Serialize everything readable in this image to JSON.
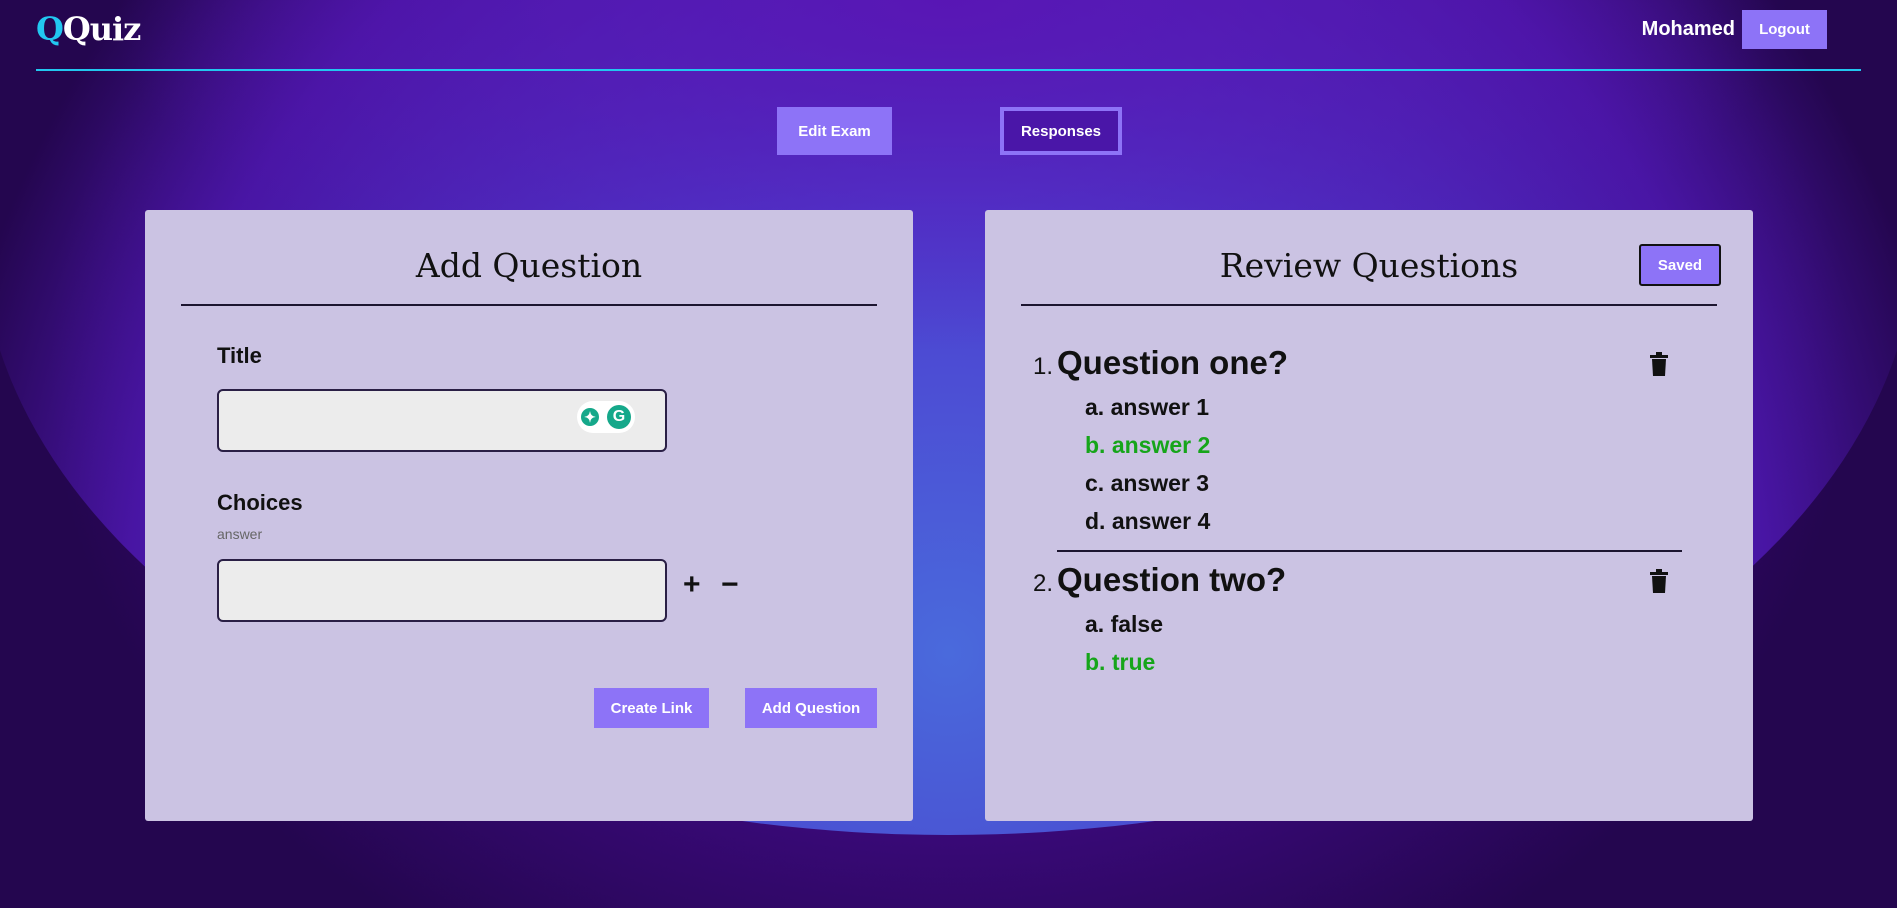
{
  "app": {
    "logo_q": "Q",
    "logo_rest": "Quiz"
  },
  "header": {
    "user_name": "Mohamed",
    "logout_label": "Logout"
  },
  "tabs": {
    "edit_exam_label": "Edit Exam",
    "responses_label": "Responses"
  },
  "add_question": {
    "title": "Add Question",
    "title_label": "Title",
    "title_value": "",
    "choices_label": "Choices",
    "choices_sublabel": "answer",
    "choice_value": "",
    "plus_symbol": "+",
    "minus_symbol": "−",
    "create_link_label": "Create Link",
    "add_question_label": "Add Question"
  },
  "review": {
    "title": "Review Questions",
    "saved_label": "Saved",
    "questions": [
      {
        "number": "1.",
        "text": "Question one?",
        "answers": [
          {
            "label": "a. answer 1",
            "correct": false
          },
          {
            "label": "b. answer 2",
            "correct": true
          },
          {
            "label": "c. answer 3",
            "correct": false
          },
          {
            "label": "d. answer 4",
            "correct": false
          }
        ]
      },
      {
        "number": "2.",
        "text": "Question two?",
        "answers": [
          {
            "label": "a. false",
            "correct": false
          },
          {
            "label": "b. true",
            "correct": true
          }
        ]
      }
    ]
  },
  "colors": {
    "accent": "#8d73f7",
    "cyan": "#22c7f0",
    "correct": "#16a51a",
    "panel": "#cbc3e3"
  }
}
